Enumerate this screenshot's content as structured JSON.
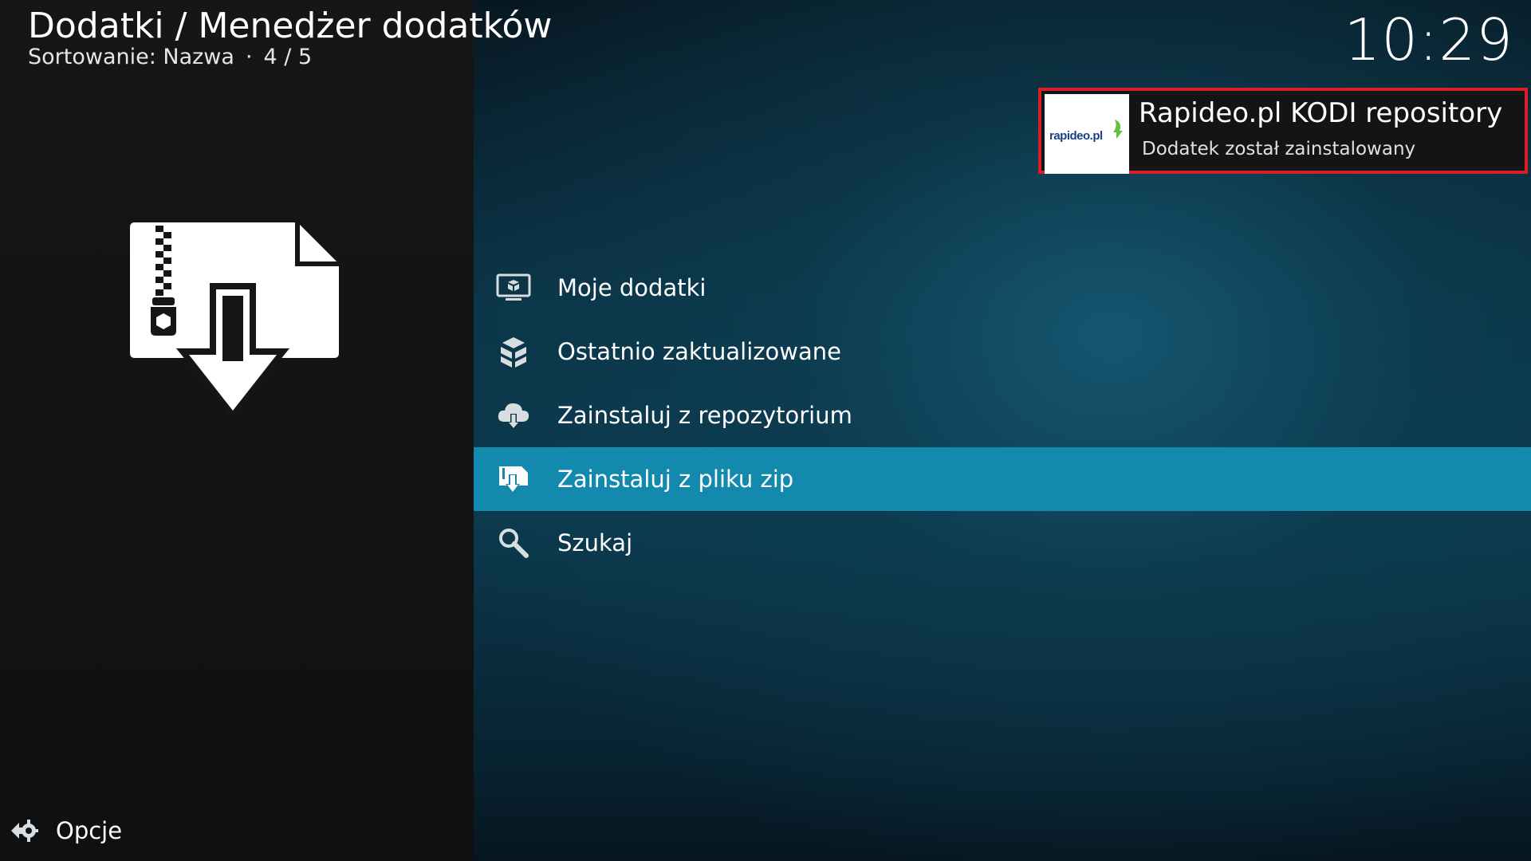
{
  "header": {
    "title": "Dodatki / Menedżer dodatków",
    "sort_label": "Sortowanie: Nazwa",
    "separator": "·",
    "position": "4 / 5"
  },
  "clock": {
    "time": "10:29"
  },
  "notification": {
    "logo_text": "rapideo.pl",
    "title": "Rapideo.pl KODI repository",
    "message": "Dodatek został zainstalowany",
    "border_color": "#d61f2a"
  },
  "preview": {
    "icon": "zip-download-icon"
  },
  "menu": {
    "items": [
      {
        "label": "Moje dodatki",
        "icon": "monitor-box-icon",
        "selected": false
      },
      {
        "label": "Ostatnio zaktualizowane",
        "icon": "boxes-stack-icon",
        "selected": false
      },
      {
        "label": "Zainstaluj z repozytorium",
        "icon": "cloud-download-icon",
        "selected": false
      },
      {
        "label": "Zainstaluj z pliku zip",
        "icon": "zip-download-icon",
        "selected": true
      },
      {
        "label": "Szukaj",
        "icon": "search-icon",
        "selected": false
      }
    ],
    "selected_color": "#1289ad"
  },
  "footer": {
    "options_label": "Opcje",
    "options_icon": "gear-arrows-icon"
  }
}
